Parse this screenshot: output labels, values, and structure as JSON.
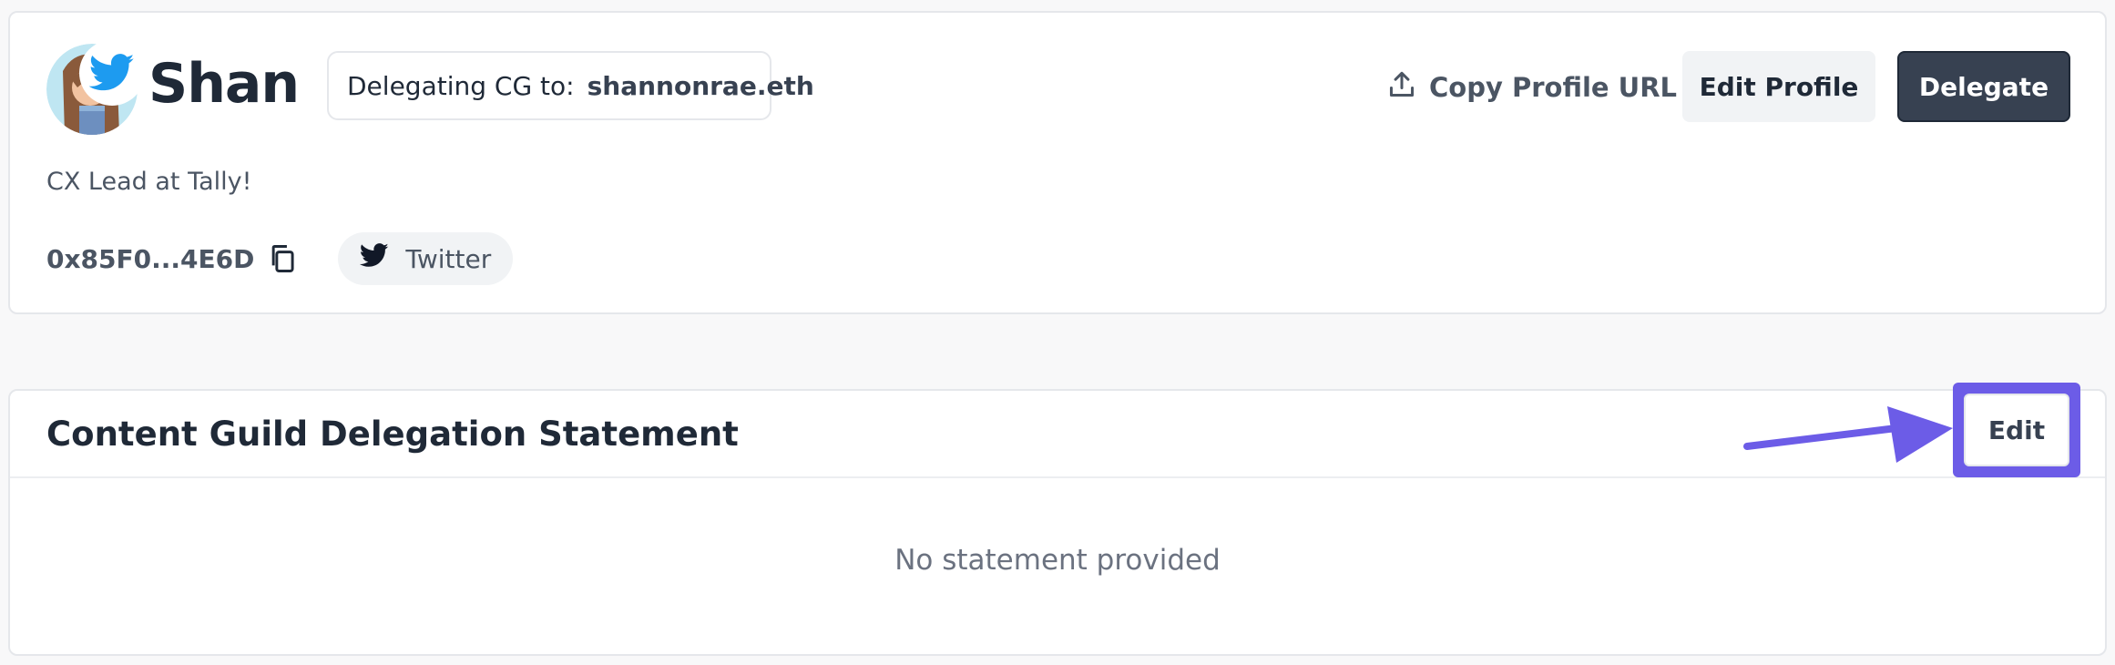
{
  "profile": {
    "name": "Shan",
    "avatar_icon": "profile-avatar",
    "badge_icon": "twitter-bird-icon",
    "delegating_label": "Delegating CG to:",
    "delegating_target": "shannonrae.eth",
    "bio": "CX Lead at Tally!",
    "address": "0x85F0...4E6D",
    "social": {
      "label": "Twitter",
      "icon": "twitter-icon"
    }
  },
  "toolbar": {
    "copy_url_label": "Copy Profile URL",
    "copy_url_icon": "upload-share-icon",
    "edit_profile_label": "Edit Profile",
    "delegate_label": "Delegate"
  },
  "statement": {
    "title": "Content Guild Delegation Statement",
    "edit_label": "Edit",
    "empty_text": "No statement provided"
  },
  "colors": {
    "primary_dark": "#374151",
    "highlight": "#6c5ce7",
    "twitter_blue": "#1d9bf0",
    "background": "#f8f8f9"
  }
}
